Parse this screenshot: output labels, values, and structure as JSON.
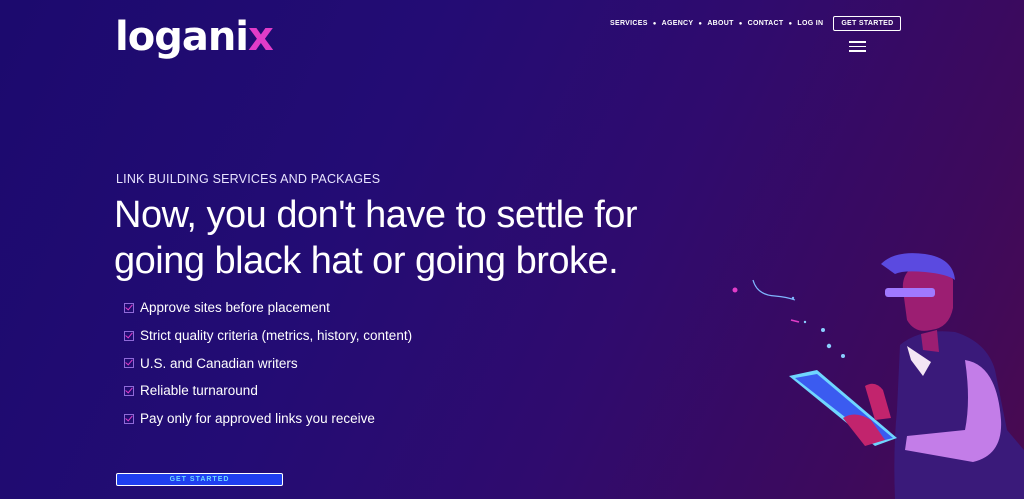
{
  "brand": {
    "logo_main": "logani",
    "logo_accent": "x"
  },
  "nav": {
    "items": [
      "SERVICES",
      "AGENCY",
      "ABOUT",
      "CONTACT",
      "LOG IN"
    ],
    "cta": "GET STARTED"
  },
  "hero": {
    "eyebrow": "LINK BUILDING SERVICES AND PACKAGES",
    "headline": "Now, you don't have to settle for going black hat or going broke.",
    "checklist": [
      "Approve sites before placement",
      "Strict quality criteria (metrics, history, content)",
      "U.S. and Canadian writers",
      "Reliable turnaround",
      "Pay only for approved links you receive"
    ],
    "cta": "GET STARTED"
  },
  "colors": {
    "accent": "#e13cc8",
    "button": "#1f3ff0",
    "background": "#230c74"
  }
}
